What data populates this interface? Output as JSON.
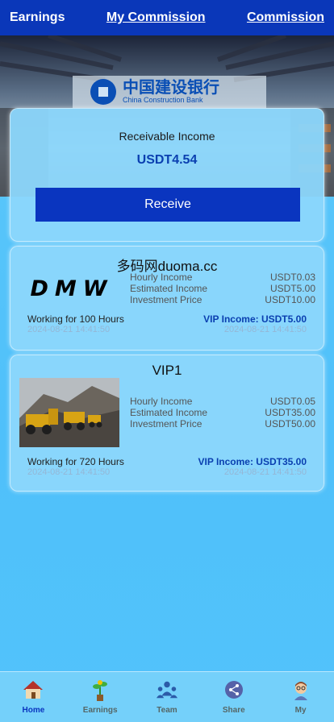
{
  "header": {
    "left_label": "Earnings",
    "center_label": "My Commission",
    "right_label": "Commission"
  },
  "banner": {
    "logo_cn": "中国建设银行",
    "logo_en": "China Construction Bank"
  },
  "receive_card": {
    "title": "Receivable Income",
    "amount": "USDT4.54",
    "button_label": "Receive"
  },
  "products": [
    {
      "name": "多码网duoma.cc",
      "thumb_text": "DMW",
      "rows": [
        {
          "label": "Hourly Income",
          "value": "USDT0.03"
        },
        {
          "label": "Estimated Income",
          "value": "USDT5.00"
        },
        {
          "label": "Investment Price",
          "value": "USDT10.00"
        }
      ],
      "working": "Working for 100 Hours",
      "vip_income": "VIP Income: USDT5.00",
      "start_date": "2024-08-21 14:41:50",
      "end_date": "2024-08-21 14:41:50"
    },
    {
      "name": "VIP1",
      "thumb_text": "",
      "rows": [
        {
          "label": "Hourly Income",
          "value": "USDT0.05"
        },
        {
          "label": "Estimated Income",
          "value": "USDT35.00"
        },
        {
          "label": "Investment Price",
          "value": "USDT50.00"
        }
      ],
      "working": "Working for 720 Hours",
      "vip_income": "VIP Income: USDT35.00",
      "start_date": "2024-08-21 14:41:50",
      "end_date": "2024-08-21 14:41:50"
    }
  ],
  "nav": [
    {
      "label": "Home",
      "icon": "home-icon",
      "active": true
    },
    {
      "label": "Earnings",
      "icon": "plant-icon"
    },
    {
      "label": "Team",
      "icon": "team-icon"
    },
    {
      "label": "Share",
      "icon": "share-icon"
    },
    {
      "label": "My",
      "icon": "avatar-icon"
    }
  ],
  "colors": {
    "header_bg": "#0a37b9",
    "accent": "#0a3fb0",
    "button_bg": "#0a35bf",
    "page_bg": "#4fc0fa"
  }
}
